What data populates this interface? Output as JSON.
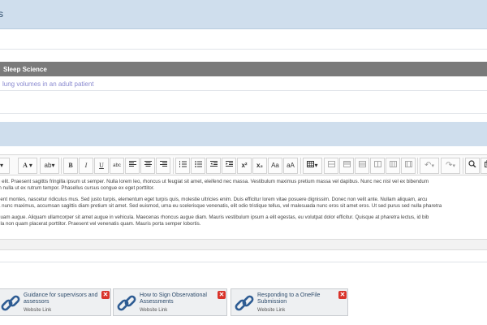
{
  "header": {
    "title": "s"
  },
  "section": {
    "title": "Sleep Science"
  },
  "topic_link": "lung volumes in an adult patient",
  "toolbar": {
    "dropdown_arrow": "▾",
    "font_color": "A",
    "highlight": "ab",
    "bold": "B",
    "italic": "I",
    "underline": "U",
    "strikethrough": "abc",
    "superscript": "x²",
    "subscript": "x₂",
    "uppercase": "Aa",
    "lowercase": "aA",
    "undo": "↶",
    "redo": "↷"
  },
  "editor": {
    "paragraphs": [
      "g elit. Praesent sagittis fringilla ipsum ut semper. Nulla lorem leo, rhoncus ut feugiat sit amet, eleifend nec massa. Vestibulum maximus pretium massa vel dapibus. Nunc nec nisl vel ex bibendum",
      "in nulla ut ex rutrum tempor. Phasellus cursus congue ex eget porttitor.",
      "rient montes, nascetur ridiculus mus. Sed justo turpis, elementum eget turpis quis, molestie ultricies enim. Duis efficitur lorem vitae posuere dignissim. Donec non velit ante. Nullam aliquam, arcu",
      "a nunc maximus, accumsan sagittis diam pretium sit amet. Sed euismod, urna eu scelerisque venenatis, elit odio tristique tellus, vel malesuada nunc eros sit amet eros. Ut sed purus sed nulla pharetra",
      "quam augue. Aliquam ullamcorper sit amet augue in vehicula. Maecenas rhoncus augue diam. Mauris vestibulum ipsum a elit egestas, eu volutpat dolor efficitur. Quisque at pharetra lectus, id bib",
      "ula non quam placerat porttitor. Praesent vel venenatis quam. Mauris porta semper lobortis."
    ]
  },
  "cards": [
    {
      "title": "Guidance for supervisors and assessors",
      "subtitle": "Website Link",
      "remove": "✕"
    },
    {
      "title": "How to Sign Observational Assessments",
      "subtitle": "Website Link",
      "remove": "✕"
    },
    {
      "title": "Responding to a OneFile Submission",
      "subtitle": "Website Link",
      "remove": "✕"
    }
  ]
}
